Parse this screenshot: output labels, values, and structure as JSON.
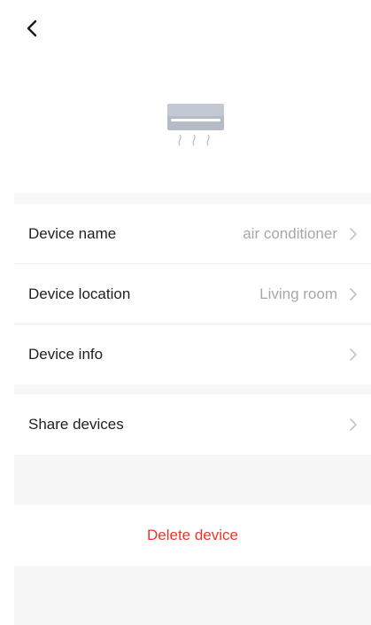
{
  "header": {
    "back_icon": "chevron-left-icon"
  },
  "device": {
    "icon": "air-conditioner-icon"
  },
  "settings": {
    "rows": [
      {
        "label": "Device name",
        "value": "air conditioner",
        "icon": "chevron-right-icon"
      },
      {
        "label": "Device location",
        "value": "Living room",
        "icon": "chevron-right-icon"
      },
      {
        "label": "Device info",
        "value": "",
        "icon": "chevron-right-icon"
      }
    ]
  },
  "share": {
    "label": "Share devices",
    "icon": "chevron-right-icon"
  },
  "actions": {
    "delete_label": "Delete device"
  },
  "colors": {
    "delete_text": "#e8372a",
    "section_background": "#f7f7f7",
    "secondary_text": "#a8a8a8"
  }
}
